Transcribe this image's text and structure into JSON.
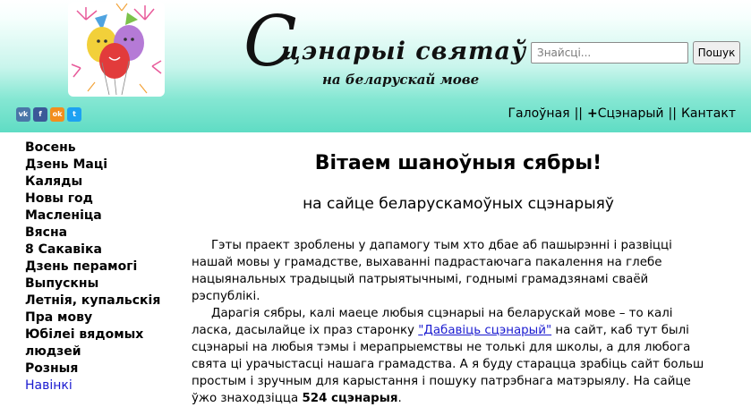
{
  "header": {
    "title_first_letter": "С",
    "title_rest": "цэнарыі  святаў",
    "subtitle": "на беларускай мове",
    "logo_icon": "balloons-logo-icon"
  },
  "search": {
    "placeholder": "Знайсці...",
    "button_label": "Пошук"
  },
  "social": [
    {
      "name": "vk-icon",
      "label": "vk",
      "color": "#4a76a8"
    },
    {
      "name": "facebook-icon",
      "label": "f",
      "color": "#3b5998"
    },
    {
      "name": "odnoklassniki-icon",
      "label": "ok",
      "color": "#f28e1e"
    },
    {
      "name": "twitter-icon",
      "label": "t",
      "color": "#1da1f2"
    }
  ],
  "top_nav": {
    "home": "Галоўная",
    "sep1": "||",
    "add_plus": "+",
    "add_label": "Сцэнарый",
    "sep2": "||",
    "contact": "Кантакт"
  },
  "sidebar": {
    "items": [
      {
        "label": "Восень"
      },
      {
        "label": "Дзень Маці"
      },
      {
        "label": "Каляды"
      },
      {
        "label": "Новы год"
      },
      {
        "label": "Масленіца"
      },
      {
        "label": "Вясна"
      },
      {
        "label": "8 Сакавіка"
      },
      {
        "label": "Дзень перамогі"
      },
      {
        "label": "Выпускны"
      },
      {
        "label": "Летнія, купальскія"
      },
      {
        "label": "Пра мову"
      },
      {
        "label": "Юбілеі вядомых"
      },
      {
        "label": "людзей"
      },
      {
        "label": "Розныя"
      },
      {
        "label": "Навінкі"
      }
    ]
  },
  "main": {
    "heading": "Вітаем шаноўныя сябры!",
    "subheading": "на сайце беларускамоўных сцэнарыяў",
    "paragraph1": "Гэты праект зроблены у дапамогу тым хто дбае аб пашырэннi i развiццi нашай мовы у грамадстве, выхаваннi падрастаючага пакалення на глебе нацыянальных традыцый патрыятычнымi, годнымi грамадзянамi сваёй рэспублiкi.",
    "paragraph2_a": "Дарагiя сябры, калi маеце любыя сцэнарыi на беларускай мове – то калi ласка, дасылайце iх праз старонку ",
    "paragraph2_link": "\"Дабавiць сцэнарый\"",
    "paragraph2_b": " на сайт, каб тут былi сцэнарыi на любыя тэмы i мерапрыемствы не толькi для школы, а для любога свята цi урачыстасцi нашага грамадства. А я буду старацца зрабiць сайт больш простым i зручным для карыстання i пошуку патрэбнага матэрыялу. На сайце ўжо знаходзiцца ",
    "count_bold": "524 сцэнарыя",
    "paragraph2_end": "."
  },
  "colors": {
    "header_gradient_bottom": "#5fdcc4",
    "link_blue": "#1a1ad0"
  }
}
